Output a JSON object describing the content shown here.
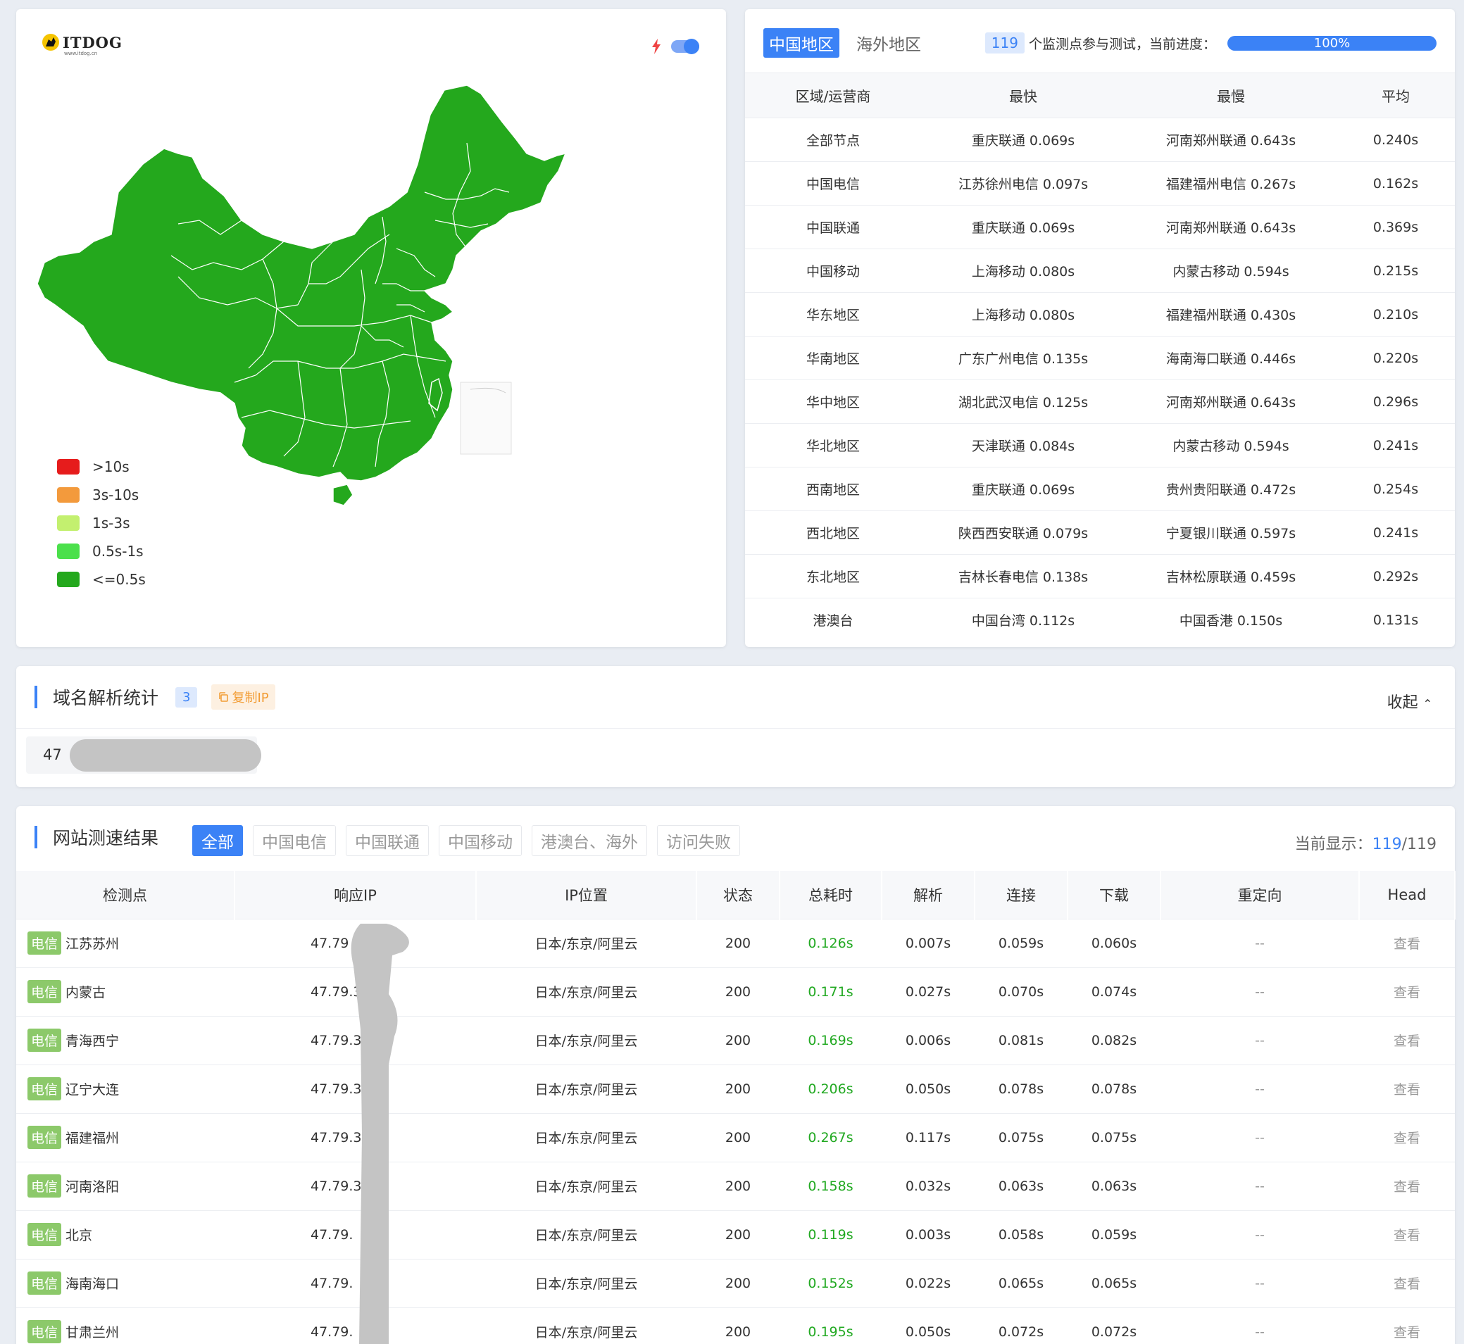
{
  "brand": {
    "name": "ITDOG",
    "sub": "www.itdog.cn"
  },
  "map": {
    "legend": [
      {
        "label": ">10s",
        "color": "#e61c1c"
      },
      {
        "label": "3s-10s",
        "color": "#f39a3c"
      },
      {
        "label": "1s-3s",
        "color": "#c3f06f"
      },
      {
        "label": "0.5s-1s",
        "color": "#4be04b"
      },
      {
        "label": "<=0.5s",
        "color": "#24a81d"
      }
    ],
    "fill": "#24a81d"
  },
  "stats": {
    "tabs": [
      "中国地区",
      "海外地区"
    ],
    "count": "119",
    "count_text": "个监测点参与测试，当前进度：",
    "progress": 1.0,
    "progress_label": "100%",
    "headers": [
      "区域/运营商",
      "最快",
      "最慢",
      "平均"
    ],
    "rows": [
      [
        "全部节点",
        "重庆联通 0.069s",
        "河南郑州联通 0.643s",
        "0.240s"
      ],
      [
        "中国电信",
        "江苏徐州电信 0.097s",
        "福建福州电信 0.267s",
        "0.162s"
      ],
      [
        "中国联通",
        "重庆联通 0.069s",
        "河南郑州联通 0.643s",
        "0.369s"
      ],
      [
        "中国移动",
        "上海移动 0.080s",
        "内蒙古移动 0.594s",
        "0.215s"
      ],
      [
        "华东地区",
        "上海移动 0.080s",
        "福建福州联通 0.430s",
        "0.210s"
      ],
      [
        "华南地区",
        "广东广州电信 0.135s",
        "海南海口联通 0.446s",
        "0.220s"
      ],
      [
        "华中地区",
        "湖北武汉电信 0.125s",
        "河南郑州联通 0.643s",
        "0.296s"
      ],
      [
        "华北地区",
        "天津联通 0.084s",
        "内蒙古移动 0.594s",
        "0.241s"
      ],
      [
        "西南地区",
        "重庆联通 0.069s",
        "贵州贵阳联通 0.472s",
        "0.254s"
      ],
      [
        "西北地区",
        "陕西西安联通 0.079s",
        "宁夏银川联通 0.597s",
        "0.241s"
      ],
      [
        "东北地区",
        "吉林长春电信 0.138s",
        "吉林松原联通 0.459s",
        "0.292s"
      ],
      [
        "港澳台",
        "中国台湾 0.112s",
        "中国香港 0.150s",
        "0.131s"
      ]
    ]
  },
  "dns": {
    "title": "域名解析统计",
    "count": "3",
    "copy_label": "复制IP",
    "collapse_label": "收起",
    "ip_prefix": "47"
  },
  "results": {
    "title": "网站测速结果",
    "filters": [
      "全部",
      "中国电信",
      "中国联通",
      "中国移动",
      "港澳台、海外",
      "访问失败"
    ],
    "show_label": "当前显示：",
    "show_current": "119",
    "show_total": "/119",
    "headers": [
      "检测点",
      "响应IP",
      "IP位置",
      "状态",
      "总耗时",
      "解析",
      "连接",
      "下载",
      "重定向",
      "Head"
    ],
    "rows": [
      {
        "isp": "电信",
        "loc": "江苏苏州",
        "ip": "47.79",
        "geo": "日本/东京/阿里云",
        "status": "200",
        "total": "0.126s",
        "dns": "0.007s",
        "conn": "0.059s",
        "dl": "0.060s",
        "redir": "--",
        "head": "查看"
      },
      {
        "isp": "电信",
        "loc": "内蒙古",
        "ip": "47.79.3",
        "geo": "日本/东京/阿里云",
        "status": "200",
        "total": "0.171s",
        "dns": "0.027s",
        "conn": "0.070s",
        "dl": "0.074s",
        "redir": "--",
        "head": "查看"
      },
      {
        "isp": "电信",
        "loc": "青海西宁",
        "ip": "47.79.3",
        "geo": "日本/东京/阿里云",
        "status": "200",
        "total": "0.169s",
        "dns": "0.006s",
        "conn": "0.081s",
        "dl": "0.082s",
        "redir": "--",
        "head": "查看"
      },
      {
        "isp": "电信",
        "loc": "辽宁大连",
        "ip": "47.79.3",
        "geo": "日本/东京/阿里云",
        "status": "200",
        "total": "0.206s",
        "dns": "0.050s",
        "conn": "0.078s",
        "dl": "0.078s",
        "redir": "--",
        "head": "查看"
      },
      {
        "isp": "电信",
        "loc": "福建福州",
        "ip": "47.79.3",
        "geo": "日本/东京/阿里云",
        "status": "200",
        "total": "0.267s",
        "dns": "0.117s",
        "conn": "0.075s",
        "dl": "0.075s",
        "redir": "--",
        "head": "查看"
      },
      {
        "isp": "电信",
        "loc": "河南洛阳",
        "ip": "47.79.3",
        "geo": "日本/东京/阿里云",
        "status": "200",
        "total": "0.158s",
        "dns": "0.032s",
        "conn": "0.063s",
        "dl": "0.063s",
        "redir": "--",
        "head": "查看"
      },
      {
        "isp": "电信",
        "loc": "北京",
        "ip": "47.79.",
        "geo": "日本/东京/阿里云",
        "status": "200",
        "total": "0.119s",
        "dns": "0.003s",
        "conn": "0.058s",
        "dl": "0.059s",
        "redir": "--",
        "head": "查看"
      },
      {
        "isp": "电信",
        "loc": "海南海口",
        "ip": "47.79.",
        "geo": "日本/东京/阿里云",
        "status": "200",
        "total": "0.152s",
        "dns": "0.022s",
        "conn": "0.065s",
        "dl": "0.065s",
        "redir": "--",
        "head": "查看"
      },
      {
        "isp": "电信",
        "loc": "甘肃兰州",
        "ip": "47.79.",
        "geo": "日本/东京/阿里云",
        "status": "200",
        "total": "0.195s",
        "dns": "0.050s",
        "conn": "0.072s",
        "dl": "0.072s",
        "redir": "--",
        "head": "查看"
      }
    ]
  }
}
